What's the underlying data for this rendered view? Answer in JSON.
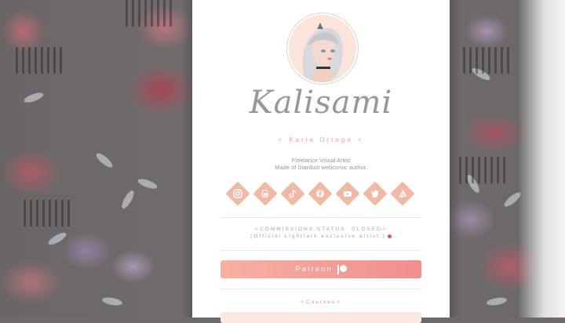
{
  "profile": {
    "display_name": "Kalisami",
    "real_name": "✧ Karla Ortega ✧",
    "bio_line1": "Freelance Visual Artist",
    "bio_line2": "Made of Stardust webcomic author."
  },
  "socials": [
    {
      "name": "instagram",
      "icon": "instagram-icon"
    },
    {
      "name": "threads",
      "icon": "threads-icon"
    },
    {
      "name": "tiktok",
      "icon": "tiktok-icon"
    },
    {
      "name": "facebook",
      "icon": "facebook-icon"
    },
    {
      "name": "youtube",
      "icon": "youtube-icon"
    },
    {
      "name": "twitter",
      "icon": "twitter-icon"
    },
    {
      "name": "artstation",
      "icon": "artstation-icon"
    }
  ],
  "status": {
    "line1": "✧COMMISSIONS STATUS: CLOSED✧",
    "line2": "(Official Lightlark exclusive artist.)"
  },
  "buttons": {
    "patreon_label": "Patreon"
  },
  "sections": {
    "courses": "✧Courses✧"
  },
  "colors": {
    "accent": "#f2b9a2",
    "button_start": "#f7b1a4",
    "button_end": "#f28e8e",
    "text_muted": "#9a9596"
  }
}
